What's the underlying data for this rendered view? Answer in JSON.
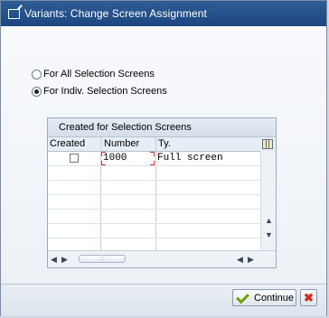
{
  "window": {
    "title": "Variants: Change Screen Assignment"
  },
  "options": {
    "radio_all": "For All Selection Screens",
    "radio_indiv": "For Indiv. Selection Screens",
    "selected": "indiv"
  },
  "table": {
    "title": "Created for Selection Screens",
    "columns": [
      "Created",
      "Number",
      "Ty."
    ],
    "rows": [
      {
        "created": false,
        "number": "1000",
        "type": "Full screen"
      }
    ]
  },
  "footer": {
    "continue_label": "Continue"
  },
  "icons": {
    "title": "edit-window-icon",
    "settings": "table-settings-icon",
    "continue": "checkmark-icon",
    "cancel": "cancel-x-icon"
  },
  "colors": {
    "title_bar": "#1f4c86",
    "continue_check": "#6da200",
    "cancel_x": "#d42b1d",
    "focus_marker": "#d0342c"
  }
}
